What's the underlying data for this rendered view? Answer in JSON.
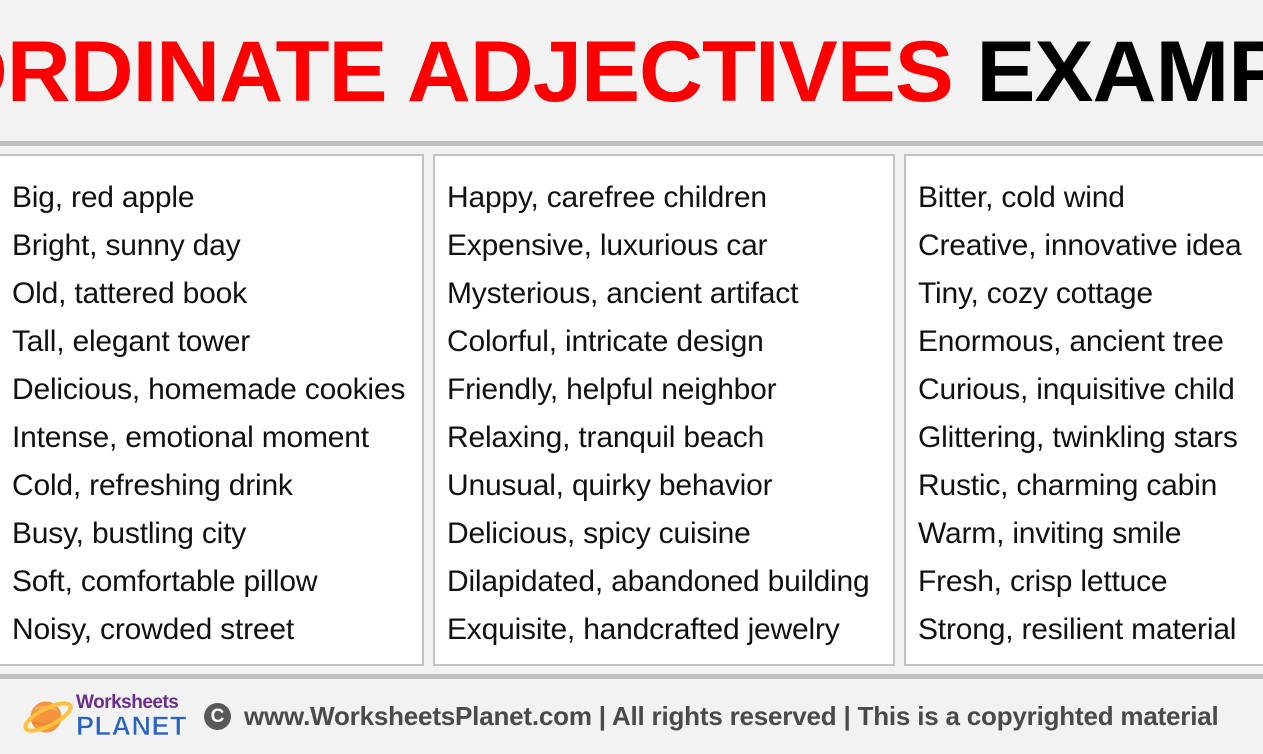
{
  "header": {
    "title_part1": "COORDINATE ADJECTIVES",
    "title_part2": "EXAMPLES",
    "title_color_red": "#FB0000",
    "title_color_black": "#000000"
  },
  "columns": [
    {
      "id": "column-1",
      "items": [
        "Big, red apple",
        "Bright, sunny day",
        "Old, tattered book",
        "Tall, elegant tower",
        "Delicious, homemade cookies",
        "Intense, emotional moment",
        "Cold, refreshing drink",
        "Busy, bustling city",
        "Soft, comfortable pillow",
        "Noisy, crowded street"
      ]
    },
    {
      "id": "column-2",
      "items": [
        "Happy, carefree children",
        "Expensive, luxurious car",
        "Mysterious, ancient artifact",
        "Colorful, intricate design",
        "Friendly, helpful neighbor",
        "Relaxing, tranquil beach",
        "Unusual, quirky behavior",
        "Delicious, spicy cuisine",
        "Dilapidated, abandoned building",
        "Exquisite, handcrafted jewelry"
      ]
    },
    {
      "id": "column-3",
      "items": [
        "Bitter, cold wind",
        "Creative, innovative idea",
        "Tiny, cozy cottage",
        "Enormous, ancient tree",
        "Curious, inquisitive child",
        "Glittering, twinkling stars",
        "Rustic, charming cabin",
        "Warm, inviting smile",
        "Fresh, crisp lettuce",
        "Strong, resilient material"
      ]
    }
  ],
  "footer": {
    "logo_top": "Worksheets",
    "logo_bottom": "PLANET",
    "logo_top_color": "#6B2D8F",
    "logo_bottom_color": "#2A63C6",
    "planet_color": "#F5933F",
    "ring_color": "#FFC13B",
    "copyright_symbol": "C",
    "text": "www.WorksheetsPlanet.com | All rights reserved | This is a copyrighted material",
    "text_color": "#4A4A4A"
  }
}
